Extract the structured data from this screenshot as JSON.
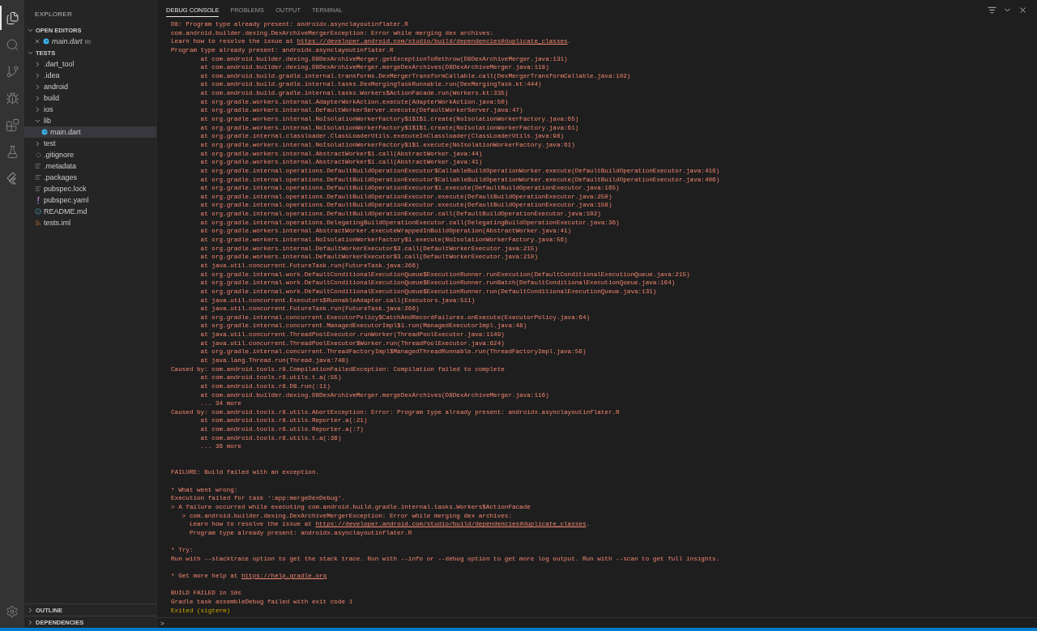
{
  "activity_bar": {
    "items": [
      {
        "kind": "explorer",
        "selected": true
      },
      {
        "kind": "search",
        "selected": false
      },
      {
        "kind": "source-control",
        "selected": false
      },
      {
        "kind": "debug",
        "selected": false
      },
      {
        "kind": "extensions",
        "selected": false
      },
      {
        "kind": "testing",
        "selected": false
      },
      {
        "kind": "flutter",
        "selected": false
      }
    ]
  },
  "sidebar": {
    "title": "EXPLORER",
    "open_editors": {
      "title": "OPEN EDITORS",
      "expanded": true,
      "items": [
        {
          "label": "main.dart",
          "detail": "lib",
          "kind": "dart"
        }
      ]
    },
    "folder": {
      "title": "TESTS",
      "expanded": true,
      "items": [
        {
          "label": ".dart_tool",
          "kind": "folder",
          "expanded": false,
          "selected": false
        },
        {
          "label": ".idea",
          "kind": "folder",
          "expanded": false,
          "selected": false
        },
        {
          "label": "android",
          "kind": "folder",
          "expanded": false,
          "selected": false
        },
        {
          "label": "build",
          "kind": "folder",
          "expanded": false,
          "selected": false
        },
        {
          "label": "ios",
          "kind": "folder",
          "expanded": false,
          "selected": false
        },
        {
          "label": "lib",
          "kind": "folder",
          "expanded": true,
          "selected": false,
          "children": [
            {
              "label": "main.dart",
              "kind": "dart",
              "selected": true
            }
          ]
        },
        {
          "label": "test",
          "kind": "folder",
          "expanded": false,
          "selected": false
        },
        {
          "label": ".gitignore",
          "kind": "git",
          "selected": false
        },
        {
          "label": ".metadata",
          "kind": "text",
          "selected": false
        },
        {
          "label": ".packages",
          "kind": "text",
          "selected": false
        },
        {
          "label": "pubspec.lock",
          "kind": "text",
          "selected": false
        },
        {
          "label": "pubspec.yaml",
          "kind": "yaml",
          "selected": false
        },
        {
          "label": "README.md",
          "kind": "info",
          "selected": false
        },
        {
          "label": "tests.iml",
          "kind": "rss",
          "selected": false
        }
      ]
    },
    "sections": [
      {
        "title": "OUTLINE",
        "expanded": false
      },
      {
        "title": "DEPENDENCIES",
        "expanded": false
      }
    ]
  },
  "panel": {
    "tabs": [
      {
        "label": "DEBUG CONSOLE",
        "selected": true
      },
      {
        "label": "PROBLEMS",
        "selected": false
      },
      {
        "label": "OUTPUT",
        "selected": false
      },
      {
        "label": "TERMINAL",
        "selected": false
      }
    ],
    "blocks": [
      {
        "kind": "single",
        "lines": [
          {
            "kind": "error",
            "text": "D8: Program type already present: androidx.asynclayoutinflater.R"
          },
          {
            "kind": "error",
            "text": "com.android.builder.dexing.DexArchiveMergerException: Error while merging dex archives:"
          },
          {
            "kind": "error",
            "text": "Learn how to resolve the issue at ",
            "link": "https://developer.android.com/studio/build/dependencies#duplicate_classes",
            "tail": "."
          },
          {
            "kind": "error",
            "text": "Program type already present: androidx.asynclayoutinflater.R"
          },
          {
            "kind": "error",
            "text": "\tat com.android.builder.dexing.D8DexArchiveMerger.getExceptionToRethrow(D8DexArchiveMerger.java:131)"
          },
          {
            "kind": "error",
            "text": "\tat com.android.builder.dexing.D8DexArchiveMerger.mergeDexArchives(D8DexArchiveMerger.java:118)"
          },
          {
            "kind": "error",
            "text": "\tat com.android.build.gradle.internal.transforms.DexMergerTransformCallable.call(DexMergerTransformCallable.java:102)"
          },
          {
            "kind": "error",
            "text": "\tat com.android.build.gradle.internal.tasks.DexMergingTaskRunnable.run(DexMergingTask.kt:444)"
          },
          {
            "kind": "error",
            "text": "\tat com.android.build.gradle.internal.tasks.Workers$ActionFacade.run(Workers.kt:335)"
          },
          {
            "kind": "error",
            "text": "\tat org.gradle.workers.internal.AdapterWorkAction.execute(AdapterWorkAction.java:50)"
          },
          {
            "kind": "error",
            "text": "\tat org.gradle.workers.internal.DefaultWorkerServer.execute(DefaultWorkerServer.java:47)"
          },
          {
            "kind": "error",
            "text": "\tat org.gradle.workers.internal.NoIsolationWorkerFactory$1$1$1.create(NoIsolationWorkerFactory.java:65)"
          },
          {
            "kind": "error",
            "text": "\tat org.gradle.workers.internal.NoIsolationWorkerFactory$1$1$1.create(NoIsolationWorkerFactory.java:61)"
          },
          {
            "kind": "error",
            "text": "\tat org.gradle.internal.classloader.ClassLoaderUtils.executeInClassloader(ClassLoaderUtils.java:98)"
          },
          {
            "kind": "error",
            "text": "\tat org.gradle.workers.internal.NoIsolationWorkerFactory$1$1.execute(NoIsolationWorkerFactory.java:61)"
          },
          {
            "kind": "error",
            "text": "\tat org.gradle.workers.internal.AbstractWorker$1.call(AbstractWorker.java:44)"
          },
          {
            "kind": "error",
            "text": "\tat org.gradle.workers.internal.AbstractWorker$1.call(AbstractWorker.java:41)"
          },
          {
            "kind": "error",
            "text": "\tat org.gradle.internal.operations.DefaultBuildOperationExecutor$CallableBuildOperationWorker.execute(DefaultBuildOperationExecutor.java:416)"
          },
          {
            "kind": "error",
            "text": "\tat org.gradle.internal.operations.DefaultBuildOperationExecutor$CallableBuildOperationWorker.execute(DefaultBuildOperationExecutor.java:406)"
          },
          {
            "kind": "error",
            "text": "\tat org.gradle.internal.operations.DefaultBuildOperationExecutor$1.execute(DefaultBuildOperationExecutor.java:165)"
          },
          {
            "kind": "error",
            "text": "\tat org.gradle.internal.operations.DefaultBuildOperationExecutor.execute(DefaultBuildOperationExecutor.java:250)"
          },
          {
            "kind": "error",
            "text": "\tat org.gradle.internal.operations.DefaultBuildOperationExecutor.execute(DefaultBuildOperationExecutor.java:158)"
          },
          {
            "kind": "error",
            "text": "\tat org.gradle.internal.operations.DefaultBuildOperationExecutor.call(DefaultBuildOperationExecutor.java:102)"
          },
          {
            "kind": "error",
            "text": "\tat org.gradle.internal.operations.DelegatingBuildOperationExecutor.call(DelegatingBuildOperationExecutor.java:36)"
          },
          {
            "kind": "error",
            "text": "\tat org.gradle.workers.internal.AbstractWorker.executeWrappedInBuildOperation(AbstractWorker.java:41)"
          },
          {
            "kind": "error",
            "text": "\tat org.gradle.workers.internal.NoIsolationWorkerFactory$1.execute(NoIsolationWorkerFactory.java:56)"
          },
          {
            "kind": "error",
            "text": "\tat org.gradle.workers.internal.DefaultWorkerExecutor$3.call(DefaultWorkerExecutor.java:215)"
          },
          {
            "kind": "error",
            "text": "\tat org.gradle.workers.internal.DefaultWorkerExecutor$3.call(DefaultWorkerExecutor.java:210)"
          },
          {
            "kind": "error",
            "text": "\tat java.util.concurrent.FutureTask.run(FutureTask.java:266)"
          },
          {
            "kind": "error",
            "text": "\tat org.gradle.internal.work.DefaultConditionalExecutionQueue$ExecutionRunner.runExecution(DefaultConditionalExecutionQueue.java:215)"
          },
          {
            "kind": "error",
            "text": "\tat org.gradle.internal.work.DefaultConditionalExecutionQueue$ExecutionRunner.runBatch(DefaultConditionalExecutionQueue.java:164)"
          },
          {
            "kind": "error",
            "text": "\tat org.gradle.internal.work.DefaultConditionalExecutionQueue$ExecutionRunner.run(DefaultConditionalExecutionQueue.java:131)"
          },
          {
            "kind": "error",
            "text": "\tat java.util.concurrent.Executors$RunnableAdapter.call(Executors.java:511)"
          },
          {
            "kind": "error",
            "text": "\tat java.util.concurrent.FutureTask.run(FutureTask.java:266)"
          },
          {
            "kind": "error",
            "text": "\tat org.gradle.internal.concurrent.ExecutorPolicy$CatchAndRecordFailures.onExecute(ExecutorPolicy.java:64)"
          },
          {
            "kind": "error",
            "text": "\tat org.gradle.internal.concurrent.ManagedExecutorImpl$1.run(ManagedExecutorImpl.java:48)"
          },
          {
            "kind": "error",
            "text": "\tat java.util.concurrent.ThreadPoolExecutor.runWorker(ThreadPoolExecutor.java:1149)"
          },
          {
            "kind": "error",
            "text": "\tat java.util.concurrent.ThreadPoolExecutor$Worker.run(ThreadPoolExecutor.java:624)"
          },
          {
            "kind": "error",
            "text": "\tat org.gradle.internal.concurrent.ThreadFactoryImpl$ManagedThreadRunnable.run(ThreadFactoryImpl.java:56)"
          },
          {
            "kind": "error",
            "text": "\tat java.lang.Thread.run(Thread.java:748)"
          },
          {
            "kind": "error",
            "text": "Caused by: com.android.tools.r8.CompilationFailedException: Compilation failed to complete"
          },
          {
            "kind": "error",
            "text": "\tat com.android.tools.r8.utils.t.a(:55)"
          },
          {
            "kind": "error",
            "text": "\tat com.android.tools.r8.D8.run(:11)"
          },
          {
            "kind": "error",
            "text": "\tat com.android.builder.dexing.D8DexArchiveMerger.mergeDexArchives(D8DexArchiveMerger.java:116)"
          },
          {
            "kind": "error",
            "text": "\t... 34 more"
          },
          {
            "kind": "error",
            "text": "Caused by: com.android.tools.r8.utils.AbortException: Error: Program type already present: androidx.asynclayoutinflater.R"
          },
          {
            "kind": "error",
            "text": "\tat com.android.tools.r8.utils.Reporter.a(:21)"
          },
          {
            "kind": "error",
            "text": "\tat com.android.tools.r8.utils.Reporter.a(:7)"
          },
          {
            "kind": "error",
            "text": "\tat com.android.tools.r8.utils.t.a(:36)"
          },
          {
            "kind": "error",
            "text": "\t... 36 more"
          }
        ]
      },
      {
        "kind": "double",
        "lines": [
          {
            "kind": "error",
            "text": "FAILURE: Build failed with an exception."
          }
        ]
      },
      {
        "kind": "single",
        "lines": [
          {
            "kind": "error",
            "text": "* What went wrong:"
          },
          {
            "kind": "error",
            "text": "Execution failed for task ':app:mergeDexDebug'."
          },
          {
            "kind": "error",
            "text": "> A failure occurred while executing com.android.build.gradle.internal.tasks.Workers$ActionFacade"
          },
          {
            "kind": "error",
            "text": "   > com.android.builder.dexing.DexArchiveMergerException: Error while merging dex archives:"
          },
          {
            "kind": "error",
            "text": "     Learn how to resolve the issue at ",
            "link": "https://developer.android.com/studio/build/dependencies#duplicate_classes",
            "tail": "."
          },
          {
            "kind": "error",
            "text": "     Program type already present: androidx.asynclayoutinflater.R"
          }
        ]
      },
      {
        "kind": "single",
        "lines": [
          {
            "kind": "error",
            "text": "* Try:"
          },
          {
            "kind": "error",
            "text": "Run with --stacktrace option to get the stack trace. Run with --info or --debug option to get more log output. Run with --scan to get full insights."
          }
        ]
      },
      {
        "kind": "single",
        "lines": [
          {
            "kind": "error",
            "text": "* Get more help at ",
            "link": "https://help.gradle.org"
          }
        ]
      },
      {
        "kind": "single",
        "lines": [
          {
            "kind": "error",
            "text": "BUILD FAILED in 10s"
          },
          {
            "kind": "error",
            "text": "Gradle task assembleDebug failed with exit code 1"
          },
          {
            "kind": "exit",
            "text": "Exited (sigterm)"
          }
        ]
      }
    ],
    "prompt": ">"
  }
}
